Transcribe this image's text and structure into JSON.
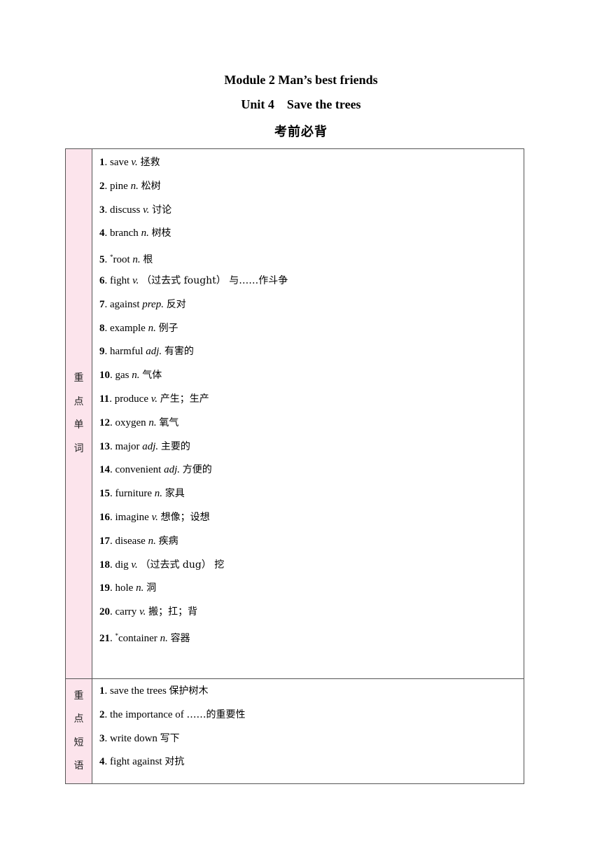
{
  "header": {
    "module": "Module 2 Man’s best friends",
    "unit": "Unit 4    Save the trees",
    "subtitle": "考前必背"
  },
  "sections": [
    {
      "label": [
        "重",
        "点",
        "单",
        "词"
      ],
      "items": [
        {
          "num": "1",
          "star": "",
          "word": "save",
          "pos": "v.",
          "meaning": "拯救"
        },
        {
          "num": "2",
          "star": "",
          "word": "pine",
          "pos": "n.",
          "meaning": "松树"
        },
        {
          "num": "3",
          "star": "",
          "word": "discuss",
          "pos": "v.",
          "meaning": "讨论"
        },
        {
          "num": "4",
          "star": "",
          "word": "branch",
          "pos": "n.",
          "meaning": "树枝"
        },
        {
          "num": "5",
          "star": "*",
          "word": "root",
          "pos": "n.",
          "meaning": "根"
        },
        {
          "num": "6",
          "star": "",
          "word": "fight",
          "pos": "v.",
          "meaning": "（过去式 fought） 与……作斗争"
        },
        {
          "num": "7",
          "star": "",
          "word": "against",
          "pos": "prep.",
          "meaning": "反对"
        },
        {
          "num": "8",
          "star": "",
          "word": "example",
          "pos": "n.",
          "meaning": "例子"
        },
        {
          "num": "9",
          "star": "",
          "word": "harmful",
          "pos": "adj.",
          "meaning": "有害的"
        },
        {
          "num": "10",
          "star": "",
          "word": "gas",
          "pos": "n.",
          "meaning": "气体"
        },
        {
          "num": "11",
          "star": "",
          "word": "produce",
          "pos": "v.",
          "meaning": "产生；生产"
        },
        {
          "num": "12",
          "star": "",
          "word": "oxygen",
          "pos": "n.",
          "meaning": "氧气"
        },
        {
          "num": "13",
          "star": "",
          "word": "major",
          "pos": "adj.",
          "meaning": "主要的"
        },
        {
          "num": "14",
          "star": "",
          "word": "convenient",
          "pos": "adj.",
          "meaning": "方便的"
        },
        {
          "num": "15",
          "star": "",
          "word": "furniture",
          "pos": "n.",
          "meaning": "家具"
        },
        {
          "num": "16",
          "star": "",
          "word": "imagine",
          "pos": "v.",
          "meaning": "想像；设想"
        },
        {
          "num": "17",
          "star": "",
          "word": "disease",
          "pos": "n.",
          "meaning": "疾病"
        },
        {
          "num": "18",
          "star": "",
          "word": "dig",
          "pos": "v.",
          "meaning": "（过去式 dug） 挖"
        },
        {
          "num": "19",
          "star": "",
          "word": "hole",
          "pos": "n.",
          "meaning": "洞"
        },
        {
          "num": "20",
          "star": "",
          "word": "carry",
          "pos": "v.",
          "meaning": "搬；扛；背"
        },
        {
          "num": "21",
          "star": "*",
          "word": "container",
          "pos": "n.",
          "meaning": "容器"
        }
      ]
    },
    {
      "label": [
        "重",
        "点",
        "短",
        "语"
      ],
      "items": [
        {
          "num": "1",
          "phrase": "save the trees",
          "meaning": "保护树木"
        },
        {
          "num": "2",
          "phrase": "the importance of",
          "meaning": "……的重要性"
        },
        {
          "num": "3",
          "phrase": "write down",
          "meaning": "写下"
        },
        {
          "num": "4",
          "phrase": "fight against",
          "meaning": "对抗"
        }
      ]
    }
  ]
}
